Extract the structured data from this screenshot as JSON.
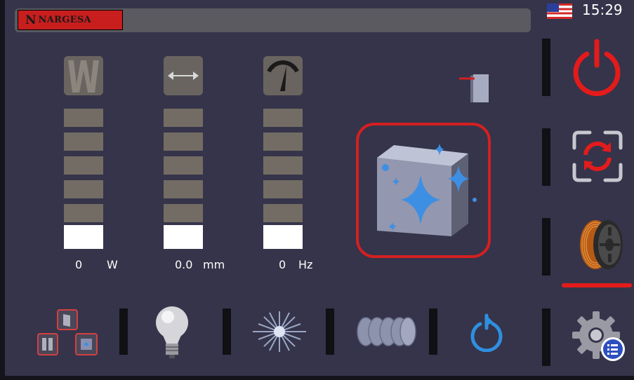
{
  "header": {
    "logo_text": "NARGESA",
    "logo_mark": "N",
    "language_flag": "us-flag-icon",
    "time": "15:29"
  },
  "meters": [
    {
      "name": "power",
      "icon": "power-w-icon",
      "header_glyph": "W",
      "value": "0",
      "unit": "W",
      "level": 0.16
    },
    {
      "name": "width",
      "icon": "width-arrow-icon",
      "value": "0.0",
      "unit": "mm",
      "level": 0.16
    },
    {
      "name": "frequency",
      "icon": "gauge-icon",
      "value": "0",
      "unit": "Hz",
      "level": 0.16
    }
  ],
  "side_buttons": [
    "power-off-icon",
    "cycle-frame-icon",
    "wire-spool-icon",
    "settings-gear-icon"
  ],
  "bottom_buttons": [
    "layout-modes-icon",
    "light-bulb-icon",
    "laser-burst-icon",
    "welding-beads-icon",
    "power-cycle-icon"
  ],
  "main": {
    "process_icon": "clean-surface-icon",
    "small_icon": "material-plate-icon"
  },
  "colors": {
    "background": "#35344a",
    "accent_red": "#e31b1b",
    "accent_blue": "#2f8fe0",
    "segment": "#736c64",
    "segment_on": "#ffffff"
  }
}
